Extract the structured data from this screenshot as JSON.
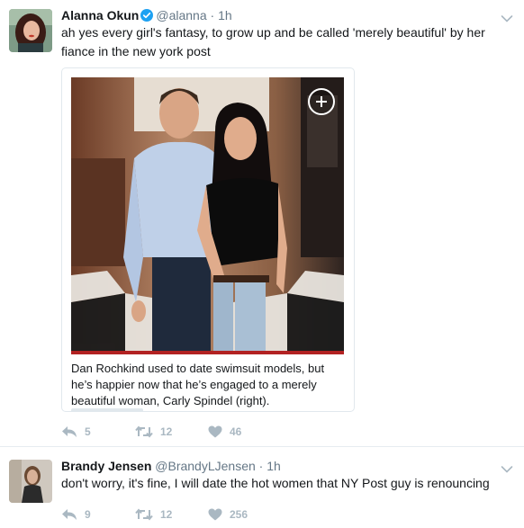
{
  "tweets": [
    {
      "name": "Alanna Okun",
      "handle": "@alanna",
      "separator": "·",
      "time": "1h",
      "verified": true,
      "text": "ah yes every girl's fantasy, to grow up and be called 'merely beautiful' by her fiance in the new york post",
      "card": {
        "caption": "Dan Rochkind used to date swimsuit models, but he’s happier now that he’s engaged to a merely beautiful woman, Carly Spindel (right)."
      },
      "replies": "5",
      "retweets": "12",
      "likes": "46"
    },
    {
      "name": "Brandy Jensen",
      "handle": "@BrandyLJensen",
      "separator": "·",
      "time": "1h",
      "verified": false,
      "text": "don't worry, it's fine, I will date the hot women that NY Post guy is renouncing",
      "replies": "9",
      "retweets": "12",
      "likes": "256"
    }
  ],
  "colors": {
    "text": "#14171a",
    "meta": "#657786",
    "action": "#aab8c2",
    "verified": "#1da1f2",
    "caption_bar": "#b22222",
    "border": "#e1e8ed"
  },
  "icons": [
    "verified-badge-icon",
    "chevron-down-icon",
    "expand-plus-icon",
    "reply-icon",
    "retweet-icon",
    "heart-icon"
  ]
}
